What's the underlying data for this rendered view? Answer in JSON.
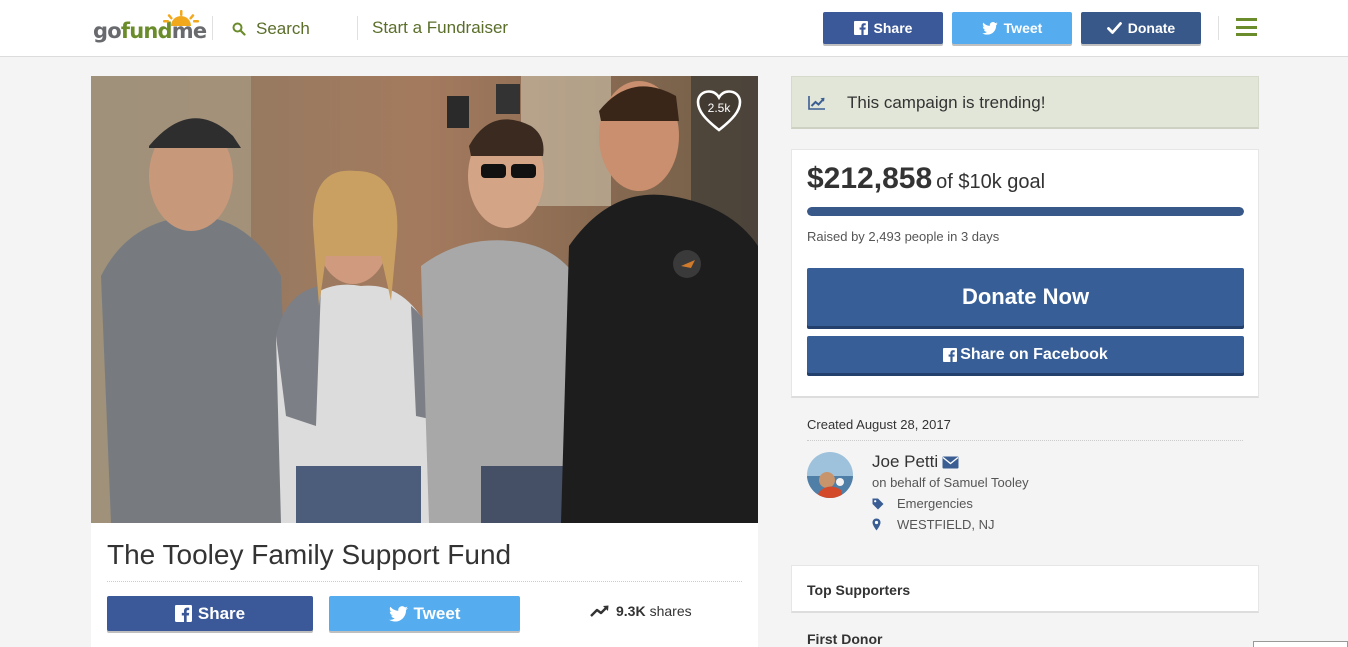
{
  "header": {
    "logo": {
      "go": "go",
      "fund": "fund",
      "me": "me"
    },
    "search_label": "Search",
    "start_fundraiser": "Start a Fundraiser",
    "share_label": "Share",
    "tweet_label": "Tweet",
    "donate_label": "Donate"
  },
  "campaign": {
    "title": "The Tooley Family Support Fund",
    "hearts": "2.5k",
    "share_label": "Share",
    "tweet_label": "Tweet",
    "shares_count": "9.3K",
    "shares_label": "shares"
  },
  "sidebar": {
    "trending": "This campaign is trending!",
    "raised_amount": "$212,858",
    "goal_text": "of $10k goal",
    "progress_fraction": 1.0,
    "raised_by": "Raised by 2,493 people in 3 days",
    "donate_now": "Donate Now",
    "share_facebook": "Share on Facebook",
    "created": "Created August 28, 2017",
    "organizer_name": "Joe Petti",
    "on_behalf": "on behalf of Samuel Tooley",
    "category": "Emergencies",
    "location": "WESTFIELD, NJ",
    "top_supporters": "Top Supporters",
    "first_donor": "First Donor"
  },
  "colors": {
    "facebook": "#3b5998",
    "twitter": "#55acee",
    "donate": "#375889",
    "brand_green": "#6b8c2a",
    "trending_bg": "#e2e6d8"
  },
  "icons": [
    "sun-logo-icon",
    "search-icon",
    "facebook-icon",
    "twitter-icon",
    "check-icon",
    "menu-icon",
    "heart-icon",
    "trend-up-icon",
    "trending-chart-icon",
    "mail-icon",
    "tag-icon",
    "map-pin-icon"
  ]
}
